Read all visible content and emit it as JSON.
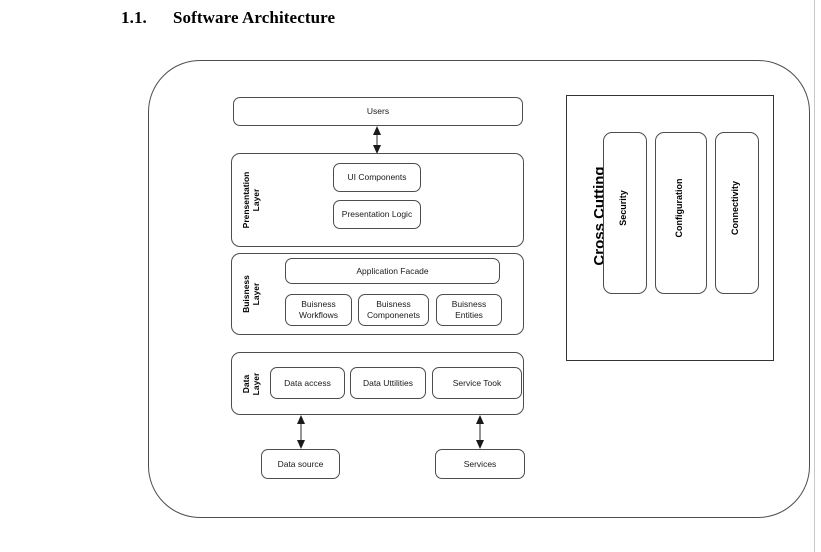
{
  "heading": {
    "number": "1.1.",
    "text": "Software Architecture"
  },
  "diagram": {
    "users": {
      "label": "Users"
    },
    "presentation_layer": {
      "title": "Prensentation\nLayer",
      "nodes": [
        {
          "label": "UI Components"
        },
        {
          "label": "Presentation Logic"
        }
      ]
    },
    "business_layer": {
      "title": "Buisness\nLayer",
      "facade": {
        "label": "Application Facade"
      },
      "nodes": [
        {
          "label": "Buisness\nWorkflows"
        },
        {
          "label": "Buisness\nComponenets"
        },
        {
          "label": "Buisness\nEntities"
        }
      ]
    },
    "data_layer": {
      "title": "Data\nLayer",
      "nodes": [
        {
          "label": "Data access"
        },
        {
          "label": "Data Uttilities"
        },
        {
          "label": "Service Took"
        }
      ]
    },
    "external": [
      {
        "label": "Data source"
      },
      {
        "label": "Services"
      }
    ],
    "cross_cutting": {
      "title": "Cross Cutting",
      "boxes": [
        {
          "label": "Security"
        },
        {
          "label": "Configuration"
        },
        {
          "label": "Connectivity"
        }
      ]
    }
  },
  "colors": {
    "stroke": "#4d4d4d",
    "panel_stroke": "#333333",
    "text": "#1a1a1a",
    "background": "#ffffff",
    "page_edge": "#c8c8c8"
  }
}
